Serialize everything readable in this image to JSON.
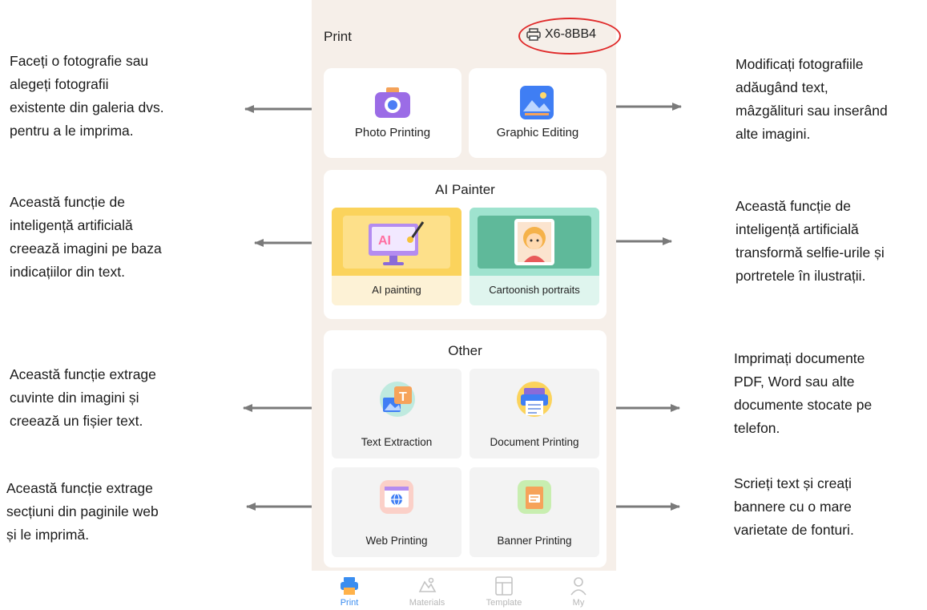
{
  "header": {
    "title": "Print",
    "device_name": "X6-8BB4",
    "device_icon": "printer-icon"
  },
  "top_tiles": [
    {
      "label": "Photo Printing",
      "icon": "camera-icon",
      "color": "#9b6ce6"
    },
    {
      "label": "Graphic Editing",
      "icon": "image-edit-icon",
      "color": "#3f7ef4"
    }
  ],
  "ai_painter": {
    "title": "AI Painter",
    "items": [
      {
        "label": "AI painting",
        "icon": "ai-monitor-icon",
        "icon_text": "AI",
        "bg": "#fdf2d6"
      },
      {
        "label": "Cartoonish portraits",
        "icon": "portrait-icon",
        "bg": "#dff5ee"
      }
    ]
  },
  "other": {
    "title": "Other",
    "items": [
      {
        "label": "Text Extraction",
        "icon": "text-extract-icon",
        "icon_text": "T"
      },
      {
        "label": "Document Printing",
        "icon": "document-print-icon"
      },
      {
        "label": "Web Printing",
        "icon": "web-icon"
      },
      {
        "label": "Banner Printing",
        "icon": "banner-icon"
      }
    ]
  },
  "tabbar": [
    {
      "label": "Print",
      "icon": "print-tab-icon",
      "active": true
    },
    {
      "label": "Materials",
      "icon": "materials-tab-icon",
      "active": false
    },
    {
      "label": "Template",
      "icon": "template-tab-icon",
      "active": false
    },
    {
      "label": "My",
      "icon": "profile-tab-icon",
      "active": false
    }
  ],
  "annotations": {
    "left": [
      [
        "Faceți o fotografie sau",
        "alegeți fotografii",
        "existente din galeria dvs.",
        "pentru a le imprima."
      ],
      [
        "Această funcție de",
        "inteligență artificială",
        "creează imagini pe baza",
        "indicațiilor din text."
      ],
      [
        "Această funcție extrage",
        "cuvinte din imagini și",
        "creează un fișier text."
      ],
      [
        "Această funcție extrage",
        "secțiuni din paginile web",
        "și le imprimă."
      ]
    ],
    "right": [
      [
        "Modificați fotografiile",
        "adăugând text,",
        "mâzgăliturі sau inserând",
        "alte imagini."
      ],
      [
        "Această funcție de",
        "inteligență artificială",
        "transformă selfie-urile și",
        "portretele în ilustrații."
      ],
      [
        "Imprimați documente",
        "PDF, Word sau alte",
        "documente stocate pe",
        "telefon."
      ],
      [
        "Scrieți text și creați",
        "bannere cu o mare",
        "varietate de fonturi."
      ]
    ]
  },
  "colors": {
    "phone_bg": "#f6efe9",
    "highlight": "#e02a2a",
    "active_tab": "#3a8df0",
    "arrow": "#7a7a7a"
  }
}
